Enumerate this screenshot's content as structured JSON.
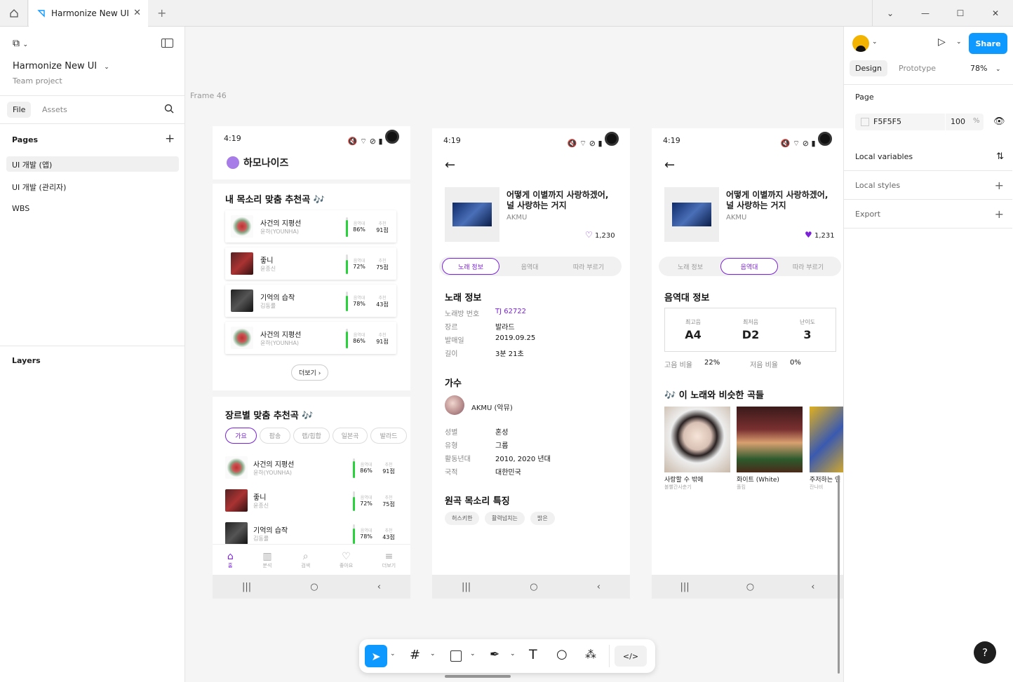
{
  "tabbar": {
    "file_tab": "Harmonize New UI"
  },
  "left": {
    "file_name": "Harmonize New UI",
    "project": "Team project",
    "tab_file": "File",
    "tab_assets": "Assets",
    "pages_title": "Pages",
    "pages": [
      "UI 개발 (앱)",
      "UI 개발 (관리자)",
      "WBS"
    ],
    "layers_title": "Layers"
  },
  "canvas": {
    "frame_label": "Frame 46",
    "status_time": "4:19",
    "p1": {
      "logo": "하모나이즈",
      "rec_title": "내 목소리 맞춤 추천곡 🎶",
      "rec_items": [
        {
          "title": "사건의 지평선",
          "singer": "윤하(YOUNHA)",
          "range_label": "음역대",
          "range": "86%",
          "score_label": "추천",
          "score": "91점",
          "fill": 0.86
        },
        {
          "title": "좋니",
          "singer": "윤종신",
          "range_label": "음역대",
          "range": "72%",
          "score_label": "추천",
          "score": "75점",
          "fill": 0.72
        },
        {
          "title": "기억의 습작",
          "singer": "김동률",
          "range_label": "음역대",
          "range": "78%",
          "score_label": "추천",
          "score": "43점",
          "fill": 0.78
        },
        {
          "title": "사건의 지평선",
          "singer": "윤하(YOUNHA)",
          "range_label": "음역대",
          "range": "86%",
          "score_label": "추천",
          "score": "91점",
          "fill": 0.86
        }
      ],
      "more": "더보기 ›",
      "genre_title": "장르별 맞춤 추천곡 🎶",
      "genres": [
        "가요",
        "팝송",
        "랩/힙합",
        "일본곡",
        "발라드"
      ],
      "genre_items": [
        {
          "title": "사건의 지평선",
          "singer": "윤하(YOUNHA)",
          "range_label": "음역대",
          "range": "86%",
          "score_label": "추천",
          "score": "91점",
          "fill": 0.86
        },
        {
          "title": "좋니",
          "singer": "윤종신",
          "range_label": "음역대",
          "range": "72%",
          "score_label": "추천",
          "score": "75점",
          "fill": 0.72
        },
        {
          "title": "기억의 습작",
          "singer": "김동률",
          "range_label": "음역대",
          "range": "78%",
          "score_label": "추천",
          "score": "43점",
          "fill": 0.78
        }
      ],
      "bottom_nav": [
        "홈",
        "분석",
        "검색",
        "좋아요",
        "더보기"
      ]
    },
    "p2": {
      "song_title_1": "어떻게 이별까지 사랑하겠어,",
      "song_title_2": "널 사랑하는 거지",
      "artist": "AKMU",
      "likes": "1,230",
      "tabs": [
        "노래 정보",
        "음역대",
        "따라 부르기"
      ],
      "info_title": "노래 정보",
      "info": [
        {
          "k": "노래방 번호",
          "v": "TJ 62722"
        },
        {
          "k": "장르",
          "v": "발라드"
        },
        {
          "k": "발매일",
          "v": "2019.09.25"
        },
        {
          "k": "길이",
          "v": "3분 21초"
        }
      ],
      "singer_title": "가수",
      "singer_name": "AKMU (악뮤)",
      "singer_info": [
        {
          "k": "성별",
          "v": "혼성"
        },
        {
          "k": "유형",
          "v": "그룹"
        },
        {
          "k": "활동년대",
          "v": "2010, 2020 년대"
        },
        {
          "k": "국적",
          "v": "대한민국"
        }
      ],
      "voice_title": "원곡 목소리 특징",
      "voice_tags": [
        "허스키한",
        "활력넘치는",
        "밝은"
      ]
    },
    "p3": {
      "song_title_1": "어떻게 이별까지 사랑하겠어,",
      "song_title_2": "널 사랑하는 거지",
      "artist": "AKMU",
      "likes": "1,231",
      "tabs": [
        "노래 정보",
        "음역대",
        "따라 부르기"
      ],
      "range_title": "음역대 정보",
      "stats": [
        {
          "label": "최고음",
          "value": "A4"
        },
        {
          "label": "최저음",
          "value": "D2"
        },
        {
          "label": "난이도",
          "value": "3"
        }
      ],
      "high_label": "고음 비율",
      "high_value": "22%",
      "low_label": "저음 비율",
      "low_value": "0%",
      "similar_title": "🎶 이 노래와 비슷한 곡들",
      "similar": [
        {
          "title": "사랑할 수 밖에",
          "singer": "볼빨간사춘기"
        },
        {
          "title": "화이트 (White)",
          "singer": "폴킴"
        },
        {
          "title": "주저하는 연",
          "singer": "잔나비"
        }
      ]
    }
  },
  "right": {
    "share": "Share",
    "tab_design": "Design",
    "tab_prototype": "Prototype",
    "zoom": "78%",
    "page_title": "Page",
    "page_color": "F5F5F5",
    "page_opacity": "100",
    "page_pct": "%",
    "local_variables": "Local variables",
    "local_styles": "Local styles",
    "export": "Export"
  },
  "colors": {
    "accent": "#7b22d8",
    "share": "#0d99ff",
    "green": "#28d23a"
  }
}
